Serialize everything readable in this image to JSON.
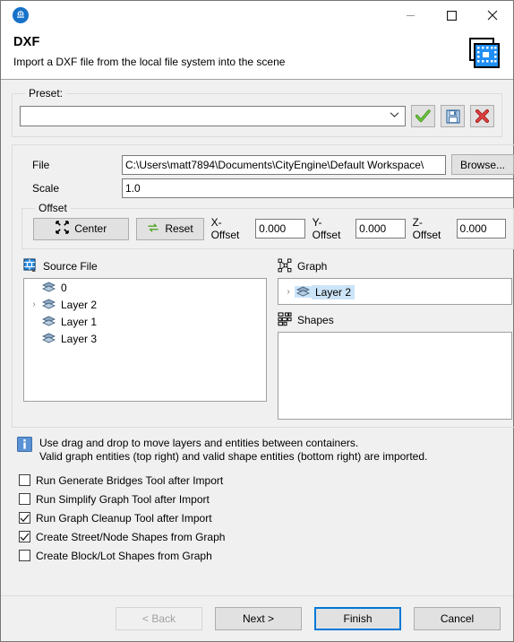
{
  "window": {
    "app_icon": "cityengine-logo-icon",
    "minimize_label": "—",
    "maximize_label": "□",
    "close_label": "✕"
  },
  "header": {
    "title": "DXF",
    "subtitle": "Import a DXF file from the local file system into the scene",
    "doc_icon": "dxf-document-icon"
  },
  "preset": {
    "legend": "Preset:",
    "value": "",
    "placeholder": "",
    "dropdown_icon": "chevron-down-icon",
    "apply_icon": "green-check-icon",
    "save_icon": "floppy-save-icon",
    "delete_icon": "red-x-icon"
  },
  "settings": {
    "file_label": "File",
    "file_value": "C:\\Users\\matt7894\\Documents\\CityEngine\\Default Workspace\\",
    "browse_label": "Browse...",
    "scale_label": "Scale",
    "scale_value": "1.0"
  },
  "offset": {
    "legend": "Offset",
    "center_label": "Center",
    "center_icon": "converge-arrows-icon",
    "reset_label": "Reset",
    "reset_icon": "refresh-arrows-icon",
    "x_label": "X-Offset",
    "x_value": "0.000",
    "y_label": "Y-Offset",
    "y_value": "0.000",
    "z_label": "Z-Offset",
    "z_value": "0.000"
  },
  "source_file": {
    "title": "Source File",
    "icon": "cad-file-icon",
    "items": [
      {
        "label": "0",
        "expandable": false,
        "icon": "layer-stack-icon"
      },
      {
        "label": "Layer 2",
        "expandable": true,
        "icon": "layer-stack-icon"
      },
      {
        "label": "Layer 1",
        "expandable": false,
        "icon": "layer-stack-icon"
      },
      {
        "label": "Layer 3",
        "expandable": false,
        "icon": "layer-stack-icon"
      }
    ]
  },
  "graph": {
    "title": "Graph",
    "icon": "network-graph-icon",
    "items": [
      {
        "label": "Layer 2",
        "expandable": true,
        "selected": true,
        "icon": "layer-stack-icon"
      }
    ]
  },
  "shapes": {
    "title": "Shapes",
    "icon": "shapes-grid-icon",
    "items": []
  },
  "info": {
    "icon": "info-icon",
    "line1": "Use drag and drop to move layers and entities between containers.",
    "line2": "Valid graph entities (top right) and valid shape entities (bottom right) are imported."
  },
  "options": [
    {
      "label": "Run Generate Bridges Tool after Import",
      "checked": false
    },
    {
      "label": "Run Simplify Graph Tool after Import",
      "checked": false
    },
    {
      "label": "Run Graph Cleanup Tool after Import",
      "checked": true
    },
    {
      "label": "Create Street/Node Shapes from Graph",
      "checked": true
    },
    {
      "label": "Create Block/Lot Shapes from Graph",
      "checked": false
    }
  ],
  "footer": {
    "back_label": "< Back",
    "next_label": "Next >",
    "finish_label": "Finish",
    "cancel_label": "Cancel"
  },
  "colors": {
    "accent": "#0078d7",
    "selection": "#cce4f7",
    "dialog_bg": "#f0f0f0",
    "ok_green": "#5aaa32",
    "error_red": "#cc2222"
  }
}
